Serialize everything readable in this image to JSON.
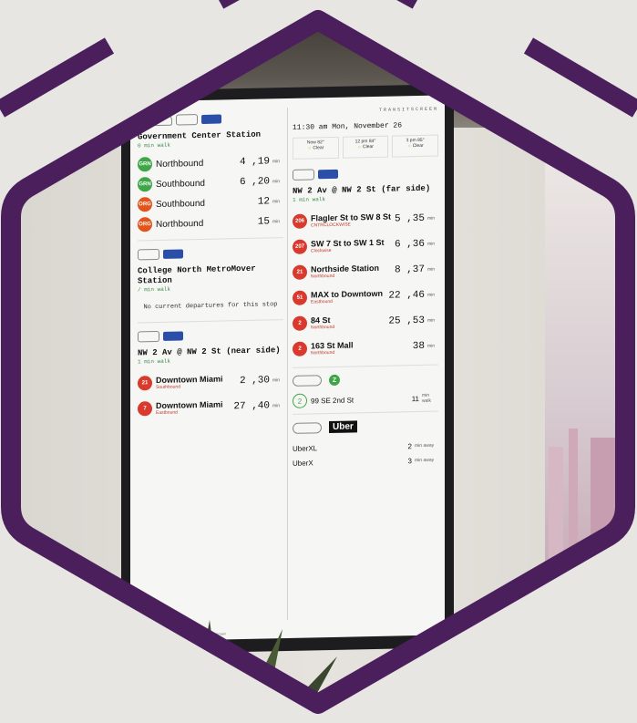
{
  "screen": {
    "brand": "TRANSITSCREEN",
    "footer": "...transitscreen.com and let us know!",
    "left_column": {
      "stations": [
        {
          "name": "Government Center Station",
          "walk": "0 min walk",
          "departures": [
            {
              "line": "GRN",
              "color": "#3fa648",
              "label": "Northbound",
              "time": "4 ,19",
              "unit": "min"
            },
            {
              "line": "GRN",
              "color": "#3fa648",
              "label": "Southbound",
              "time": "6 ,20",
              "unit": "min"
            },
            {
              "line": "ORG",
              "color": "#e2541b",
              "label": "Southbound",
              "time": "12",
              "unit": "min"
            },
            {
              "line": "ORG",
              "color": "#e2541b",
              "label": "Northbound",
              "time": "15",
              "unit": "min"
            }
          ]
        },
        {
          "name": "College North MetroMover Station",
          "walk": "/ min walk",
          "no_departures": "No current departures for this stop"
        },
        {
          "name": "NW 2 Av @ NW 2 St (near side)",
          "walk": "1 min walk",
          "bus_departures": [
            {
              "route": "21",
              "color": "#d83a2e",
              "dest": "Downtown Miami",
              "dir": "Southbound",
              "time": "2 ,30",
              "unit": "min"
            },
            {
              "route": "7",
              "color": "#d83a2e",
              "dest": "Downtown Miami",
              "dir": "Eastbound",
              "time": "27 ,40",
              "unit": "min"
            }
          ]
        }
      ]
    },
    "right_column": {
      "clock": "11:30 am  Mon, November 26",
      "weather": [
        {
          "label": "Now 82°",
          "cond": "Clear"
        },
        {
          "label": "12 pm 84°",
          "cond": "Clear"
        },
        {
          "label": "3 pm 85°",
          "cond": "Clear"
        }
      ],
      "station": {
        "name": "NW 2 Av @ NW 2 St (far side)",
        "walk": "1 min walk",
        "bus_departures": [
          {
            "route": "206",
            "color": "#d83a2e",
            "dest": "Flagler St to SW 8 St",
            "dir": "CNTRCLOCKWISE",
            "time": "5 ,35",
            "unit": "min"
          },
          {
            "route": "207",
            "color": "#d83a2e",
            "dest": "SW 7 St to SW 1 St",
            "dir": "Clockwise",
            "time": "6 ,36",
            "unit": "min"
          },
          {
            "route": "21",
            "color": "#d83a2e",
            "dest": "Northside Station",
            "dir": "Northbound",
            "time": "8 ,37",
            "unit": "min"
          },
          {
            "route": "51",
            "color": "#d83a2e",
            "dest": "MAX to Downtown",
            "dir": "Eastbound",
            "time": "22 ,46",
            "unit": "min"
          },
          {
            "route": "2",
            "color": "#d83a2e",
            "dest": "84 St",
            "dir": "Northbound",
            "time": "25 ,53",
            "unit": "min"
          },
          {
            "route": "2",
            "color": "#d83a2e",
            "dest": "163 St Mall",
            "dir": "Northbound",
            "time": "38",
            "unit": "min"
          }
        ]
      },
      "zipcar": {
        "logo": "Z",
        "count": "2",
        "location": "99 SE 2nd St",
        "walk_time": "11",
        "walk_unit": "min walk"
      },
      "uber": {
        "logo": "Uber",
        "options": [
          {
            "name": "UberXL",
            "eta": "2",
            "unit": "min away"
          },
          {
            "name": "UberX",
            "eta": "3",
            "unit": "min away"
          }
        ]
      }
    }
  },
  "colors": {
    "frame_purple": "#4a1f5c",
    "green_line": "#3fa648",
    "orange_line": "#e2541b",
    "bus_red": "#d83a2e"
  }
}
